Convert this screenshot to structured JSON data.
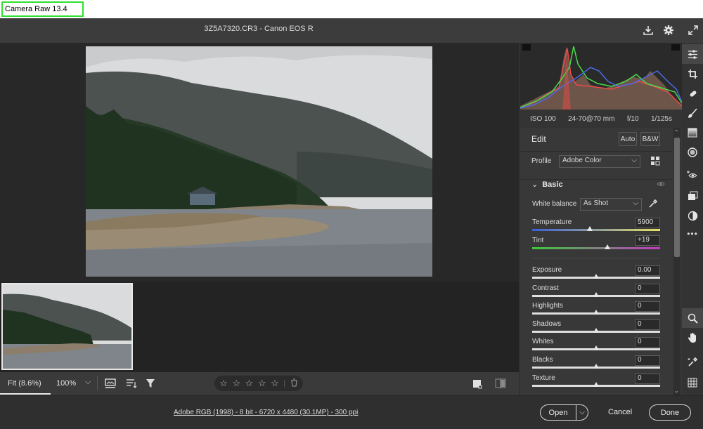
{
  "app": {
    "title": "Camera Raw 13.4"
  },
  "header": {
    "filename": "3Z5A7320.CR3  -  Canon EOS R"
  },
  "exif": {
    "iso": "ISO 100",
    "lens": "24-70@70 mm",
    "aperture": "f/10",
    "shutter": "1/125s"
  },
  "edit": {
    "title": "Edit",
    "auto_label": "Auto",
    "bw_label": "B&W",
    "profile_label": "Profile",
    "profile_value": "Adobe Color",
    "section_title": "Basic",
    "white_balance_label": "White balance",
    "white_balance_value": "As Shot",
    "temperature": {
      "label": "Temperature",
      "value": "5900",
      "position": 0.45
    },
    "tint": {
      "label": "Tint",
      "value": "+19",
      "position": 0.59
    },
    "sliders": [
      {
        "label": "Exposure",
        "value": "0.00",
        "position": 0.5
      },
      {
        "label": "Contrast",
        "value": "0",
        "position": 0.5
      },
      {
        "label": "Highlights",
        "value": "0",
        "position": 0.5
      },
      {
        "label": "Shadows",
        "value": "0",
        "position": 0.5
      },
      {
        "label": "Whites",
        "value": "0",
        "position": 0.5
      },
      {
        "label": "Blacks",
        "value": "0",
        "position": 0.5
      },
      {
        "label": "Texture",
        "value": "0",
        "position": 0.5
      }
    ]
  },
  "toolbar": {
    "zoom_fit": "Fit (8.6%)",
    "zoom_100": "100%"
  },
  "status": {
    "workflow": "Adobe RGB (1998) - 8 bit - 6720 x 4480 (30.1MP) - 300 ppi",
    "open_label": "Open",
    "cancel_label": "Cancel",
    "done_label": "Done"
  },
  "rating": {
    "stars": 0,
    "max": 5
  },
  "colors": {
    "highlight": "#2ee02e",
    "histogram_red": "#e84a4a",
    "histogram_green": "#4adb4a",
    "histogram_blue": "#4a6ae8"
  }
}
